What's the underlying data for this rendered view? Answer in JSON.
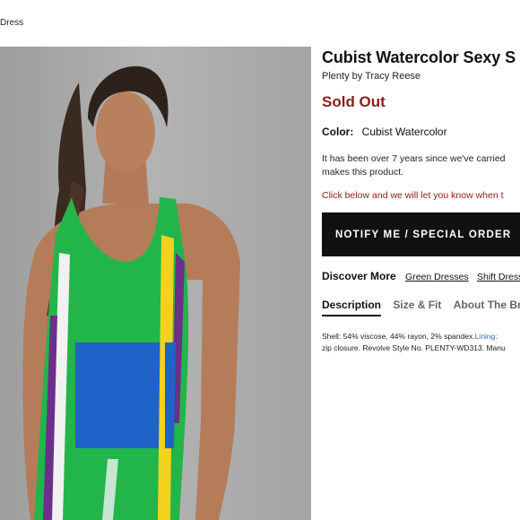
{
  "breadcrumb": {
    "label": "Dress"
  },
  "product": {
    "title": "Cubist Watercolor Sexy S",
    "brand": "Plenty by Tracy Reese",
    "status": "Sold Out",
    "color_label": "Color:",
    "color_value": "Cubist Watercolor",
    "availability_note_line1": "It has been over 7 years since we've carried",
    "availability_note_line2": "makes this product.",
    "notify_text": "Click below and we will let you know when t",
    "notify_button": "NOTIFY ME / SPECIAL ORDER"
  },
  "discover": {
    "label": "Discover More",
    "links": [
      "Green Dresses",
      "Shift Dresse"
    ]
  },
  "tabs": [
    {
      "label": "Description",
      "active": true
    },
    {
      "label": "Size & Fit",
      "active": false
    },
    {
      "label": "About The Br",
      "active": false
    }
  ],
  "description": {
    "line1_a": "Shell: 54% viscose, 44% rayon, 2% spandex.",
    "line1_b": "Lining:",
    "line2": "zip closure. Revolve Style No. PLENTY-WD313. Manu"
  },
  "colors": {
    "sold_out": "#8b1d1d",
    "button_bg": "#111111",
    "photo_bg": "#a9a9a9",
    "dress_green": "#1fb84a",
    "dress_blue": "#1f63c8",
    "dress_yellow": "#f2d21c",
    "dress_purple": "#6c2f8a"
  }
}
